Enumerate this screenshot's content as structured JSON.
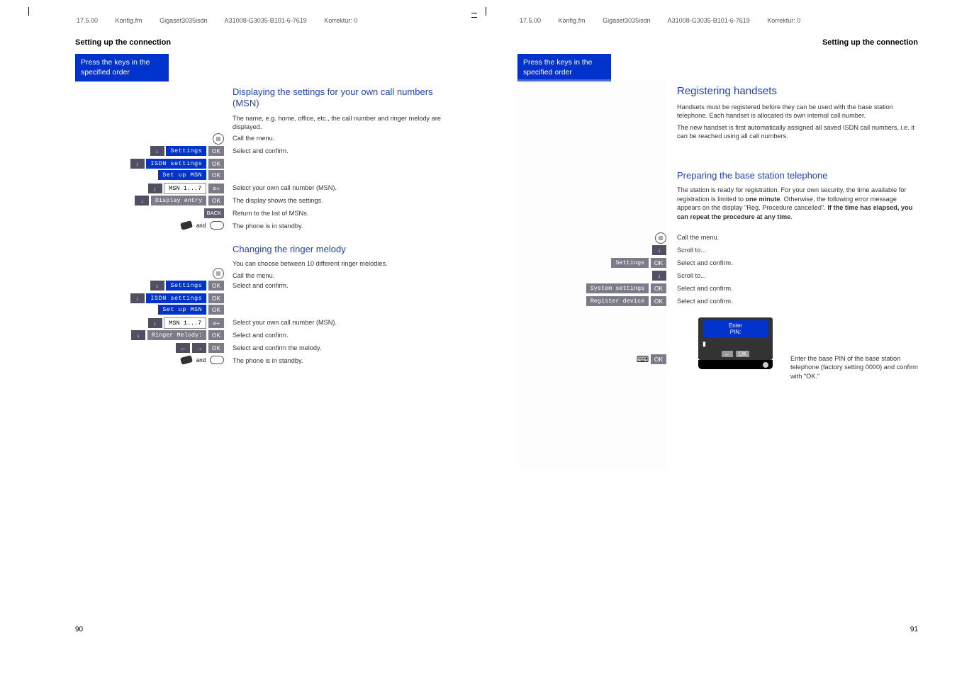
{
  "header": {
    "date": "17.5.00",
    "file": "Konfig.fm",
    "product": "Gigaset3035isdn",
    "partno": "A31008-G3035-B101-6-7619",
    "korr": "Korrektur: 0"
  },
  "left_page": {
    "section_title": "Setting up the connection",
    "keys_box_l1": "Press the keys in the",
    "keys_box_l2": "specified order",
    "h1": "Displaying the settings for your own call numbers (MSN)",
    "p1": "The name, e.g. home, office, etc., the call number and ringer melody are displayed.",
    "call_menu": "Call the menu.",
    "settings": "Settings",
    "select_confirm": "Select and confirm.",
    "isdn_settings": "ISDN settings",
    "set_up_msn": "Set up MSN",
    "msn17": "MSN 1...7",
    "select_own": "Select your own call number (MSN).",
    "display_entry": "Display entry",
    "display_shows": "The display shows the settings.",
    "return_list": "Return to the list of MSNs.",
    "standby": "The phone is in standby.",
    "h2": "Changing the ringer melody",
    "p2": "You can choose between 10 different ringer melodies.",
    "ringer_melody": "Ringer Melody:",
    "select_conf_melody": "Select and confirm the melody.",
    "ok": "OK",
    "back": "BACK",
    "and": "and",
    "page_num": "90"
  },
  "right_page": {
    "section_title": "Setting up the connection",
    "keys_box_l1": "Press the keys in the",
    "keys_box_l2": "specified order",
    "h1": "Registering handsets",
    "p1": "Handsets must be registered before they can be used with the base station telephone. Each handset is allocated its own internal call number.",
    "p2": "The new handset is first automatically assigned all saved ISDN call numbers, i.e. it can be reached using all call numbers.",
    "h2": "Preparing the base station telephone",
    "p3a": "The station is ready for registration. For your own security, the time available for registration is limited to ",
    "p3b": "one minute",
    "p3c": ". Otherwise, the following error message appears on the display \"Reg. Procedure cancelled\". ",
    "p3d": "If the time has elapsed, you can repeat the procedure at any time",
    "p3e": ".",
    "call_menu": "Call the menu.",
    "scroll_to": "Scroll to...",
    "settings": "Settings",
    "select_confirm": "Select and confirm.",
    "system_settings": "System settings",
    "register_device": "Register device",
    "enter": "Enter",
    "pin": "PIN:",
    "diagram_ok": "OK",
    "pin_note": "Enter the base PIN of the base station telephone (factory setting 0000) and confirm with \"OK.\"",
    "ok": "OK",
    "page_num": "91"
  }
}
